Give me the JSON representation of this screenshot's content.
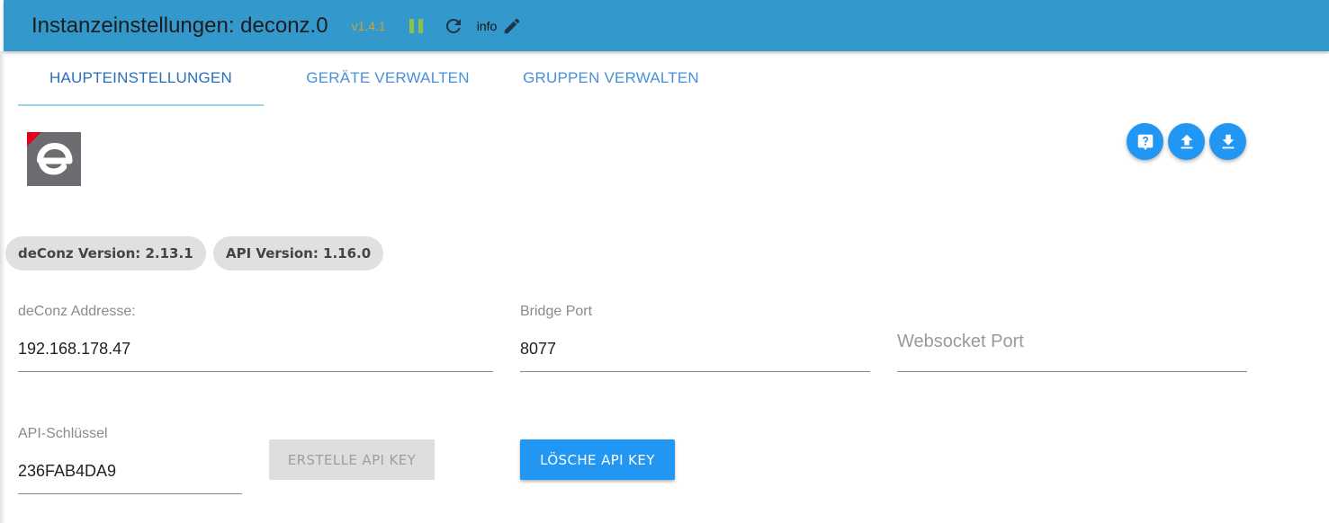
{
  "header": {
    "title": "Instanzeinstellungen: deconz.0",
    "version": "v1.4.1",
    "log_level": "info",
    "pause_icon": "pause-icon",
    "reload_icon": "reload-icon",
    "edit_icon": "pencil-icon",
    "background_color": "#3399cc"
  },
  "tabs": [
    {
      "label": "HAUPTEINSTELLUNGEN",
      "active": true
    },
    {
      "label": "GERÄTE VERWALTEN",
      "active": false
    },
    {
      "label": "GRUPPEN VERWALTEN",
      "active": false
    }
  ],
  "logo": {
    "icon": "deconz-logo-icon"
  },
  "actions": [
    {
      "icon": "help-icon"
    },
    {
      "icon": "upload-icon"
    },
    {
      "icon": "download-icon"
    }
  ],
  "chips": {
    "deconz_version": "deConz Version: 2.13.1",
    "api_version": "API Version: 1.16.0"
  },
  "fields": {
    "address": {
      "label": "deConz Addresse:",
      "value": "192.168.178.47"
    },
    "bridge_port": {
      "label": "Bridge Port",
      "value": "8077"
    },
    "websocket_port": {
      "placeholder": "Websocket Port",
      "value": ""
    },
    "api_key": {
      "label": "API-Schlüssel",
      "value": "236FAB4DA9"
    }
  },
  "buttons": {
    "create_api_key": "ERSTELLE API KEY",
    "delete_api_key": "LÖSCHE API KEY"
  },
  "colors": {
    "accent": "#2196f3",
    "version_text": "#c9a43a",
    "pause_green": "#8bc34a"
  }
}
